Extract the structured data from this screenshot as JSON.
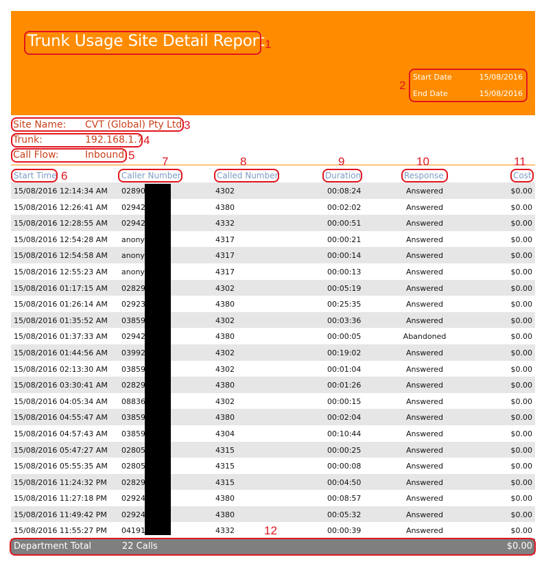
{
  "report": {
    "title": "Trunk Usage Site Detail Report",
    "start_date_label": "Start Date",
    "start_date": "15/08/2016",
    "end_date_label": "End Date",
    "end_date": "15/08/2016"
  },
  "site": {
    "site_name_label": "Site Name:",
    "site_name": "CVT (Global) Pty Ltd",
    "trunk_label": "Trunk:",
    "trunk": "192.168.1.7",
    "call_flow_label": "Call Flow:",
    "call_flow": "Inbound"
  },
  "table": {
    "headers": [
      "Start Time",
      "Caller Number",
      "Called Number",
      "Duration",
      "Response",
      "Cost"
    ],
    "rows": [
      {
        "start": "15/08/2016 12:14:34 AM",
        "caller": "02890",
        "called": "4302",
        "duration": "00:08:24",
        "response": "Answered",
        "cost": "$0.00"
      },
      {
        "start": "15/08/2016 12:26:41 AM",
        "caller": "02942",
        "called": "4380",
        "duration": "00:02:02",
        "response": "Answered",
        "cost": "$0.00"
      },
      {
        "start": "15/08/2016 12:28:55 AM",
        "caller": "02942",
        "called": "4332",
        "duration": "00:00:51",
        "response": "Answered",
        "cost": "$0.00"
      },
      {
        "start": "15/08/2016 12:54:28 AM",
        "caller": "anony",
        "called": "4317",
        "duration": "00:00:21",
        "response": "Answered",
        "cost": "$0.00"
      },
      {
        "start": "15/08/2016 12:54:58 AM",
        "caller": "anony",
        "called": "4317",
        "duration": "00:00:14",
        "response": "Answered",
        "cost": "$0.00"
      },
      {
        "start": "15/08/2016 12:55:23 AM",
        "caller": "anony",
        "called": "4317",
        "duration": "00:00:13",
        "response": "Answered",
        "cost": "$0.00"
      },
      {
        "start": "15/08/2016 01:17:15 AM",
        "caller": "02829",
        "called": "4302",
        "duration": "00:05:19",
        "response": "Answered",
        "cost": "$0.00"
      },
      {
        "start": "15/08/2016 01:26:14 AM",
        "caller": "02923",
        "called": "4380",
        "duration": "00:25:35",
        "response": "Answered",
        "cost": "$0.00"
      },
      {
        "start": "15/08/2016 01:35:52 AM",
        "caller": "03859",
        "called": "4302",
        "duration": "00:03:36",
        "response": "Answered",
        "cost": "$0.00"
      },
      {
        "start": "15/08/2016 01:37:33 AM",
        "caller": "02942",
        "called": "4380",
        "duration": "00:00:05",
        "response": "Abandoned",
        "cost": "$0.00"
      },
      {
        "start": "15/08/2016 01:44:56 AM",
        "caller": "03992",
        "called": "4302",
        "duration": "00:19:02",
        "response": "Answered",
        "cost": "$0.00"
      },
      {
        "start": "15/08/2016 02:13:30 AM",
        "caller": "03859",
        "called": "4302",
        "duration": "00:01:04",
        "response": "Answered",
        "cost": "$0.00"
      },
      {
        "start": "15/08/2016 03:30:41 AM",
        "caller": "02829",
        "called": "4380",
        "duration": "00:01:26",
        "response": "Answered",
        "cost": "$0.00"
      },
      {
        "start": "15/08/2016 04:05:34 AM",
        "caller": "08836",
        "called": "4302",
        "duration": "00:00:15",
        "response": "Answered",
        "cost": "$0.00"
      },
      {
        "start": "15/08/2016 04:55:47 AM",
        "caller": "03859",
        "called": "4380",
        "duration": "00:02:04",
        "response": "Answered",
        "cost": "$0.00"
      },
      {
        "start": "15/08/2016 04:57:43 AM",
        "caller": "03859",
        "called": "4304",
        "duration": "00:10:44",
        "response": "Answered",
        "cost": "$0.00"
      },
      {
        "start": "15/08/2016 05:47:27 AM",
        "caller": "02805",
        "called": "4315",
        "duration": "00:00:25",
        "response": "Answered",
        "cost": "$0.00"
      },
      {
        "start": "15/08/2016 05:55:35 AM",
        "caller": "02805",
        "called": "4315",
        "duration": "00:00:08",
        "response": "Answered",
        "cost": "$0.00"
      },
      {
        "start": "15/08/2016 11:24:32 PM",
        "caller": "02829",
        "called": "4315",
        "duration": "00:04:50",
        "response": "Answered",
        "cost": "$0.00"
      },
      {
        "start": "15/08/2016 11:27:18 PM",
        "caller": "02924",
        "called": "4380",
        "duration": "00:08:57",
        "response": "Answered",
        "cost": "$0.00"
      },
      {
        "start": "15/08/2016 11:49:42 PM",
        "caller": "02924",
        "called": "4380",
        "duration": "00:05:32",
        "response": "Answered",
        "cost": "$0.00"
      },
      {
        "start": "15/08/2016 11:55:27 PM",
        "caller": "04191",
        "called": "4332",
        "duration": "00:00:39",
        "response": "Answered",
        "cost": "$0.00"
      }
    ]
  },
  "total": {
    "label": "Department Total",
    "calls": "22 Calls",
    "cost": "$0.00"
  },
  "annotations": [
    "1",
    "2",
    "3",
    "4",
    "5",
    "6",
    "7",
    "8",
    "9",
    "10",
    "11",
    "12"
  ],
  "colors": {
    "header_band": "#ff8c00",
    "annotation": "#e0141e",
    "site_text": "#c8401a",
    "column_header": "#7a9ac6",
    "alt_row": "#e6e6e6",
    "total_bar": "#7f7f7f"
  }
}
